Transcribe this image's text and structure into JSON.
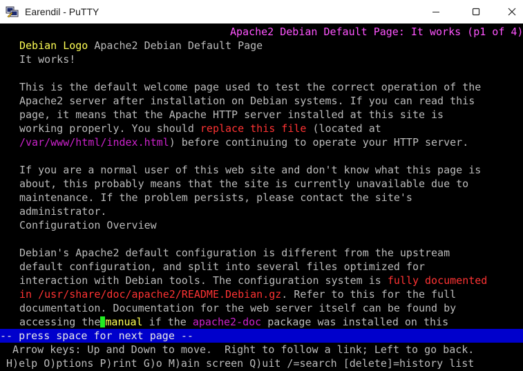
{
  "window": {
    "title": "Earendil - PuTTY",
    "icons": {
      "app": "putty-icon",
      "minimize": "minimize-icon",
      "maximize": "maximize-icon",
      "close": "close-icon"
    }
  },
  "terminal": {
    "header": "Apache2 Debian Default Page: It works (p1 of 4)",
    "logo_link": "Debian Logo",
    "page_title": " Apache2 Debian Default Page",
    "heading": "It works!",
    "p1": {
      "l1": "This is the default welcome page used to test the correct operation of the",
      "l2": "Apache2 server after installation on Debian systems. If you can read this",
      "l3": "page, it means that the Apache HTTP server installed at this site is",
      "l4a": "working properly. You should ",
      "l4_link": "replace this file",
      "l4b": " (located at",
      "l5_path": "/var/www/html/index.html",
      "l5b": ") before continuing to operate your HTTP server."
    },
    "p2": {
      "l1": "If you are a normal user of this web site and don't know what this page is",
      "l2": "about, this probably means that the site is currently unavailable due to",
      "l3": "maintenance. If the problem persists, please contact the site's",
      "l4": "administrator."
    },
    "section_heading": "Configuration Overview",
    "p3": {
      "l1": "Debian's Apache2 default configuration is different from the upstream",
      "l2": "default configuration, and split into several files optimized for",
      "l3a": "interaction with Debian tools. The configuration system is ",
      "l3_link": "fully documented",
      "l4_link": "in /usr/share/doc/apache2/README.Debian.gz",
      "l4b": ". Refer to this for the full",
      "l5": "documentation. Documentation for the web server itself can be found by",
      "l6a": "accessing the",
      "l6_link1": "manual",
      "l6b": " if the ",
      "l6_link2": "apache2-doc",
      "l6c": " package was installed on this"
    },
    "status": "-- press space for next page --",
    "help1": "  Arrow keys: Up and Down to move.  Right to follow a link; Left to go back.",
    "help2": " H)elp O)ptions P)rint G)o M)ain screen Q)uit /=search [delete]=history list"
  },
  "colors": {
    "background": "#000000",
    "text": "#bbbbbb",
    "header": "#ff55ff",
    "link_current": "#ffff55",
    "link_red": "#ff3333",
    "link_magenta": "#cc22cc",
    "cursor": "#22ee22",
    "statusbar": "#0000cc"
  }
}
